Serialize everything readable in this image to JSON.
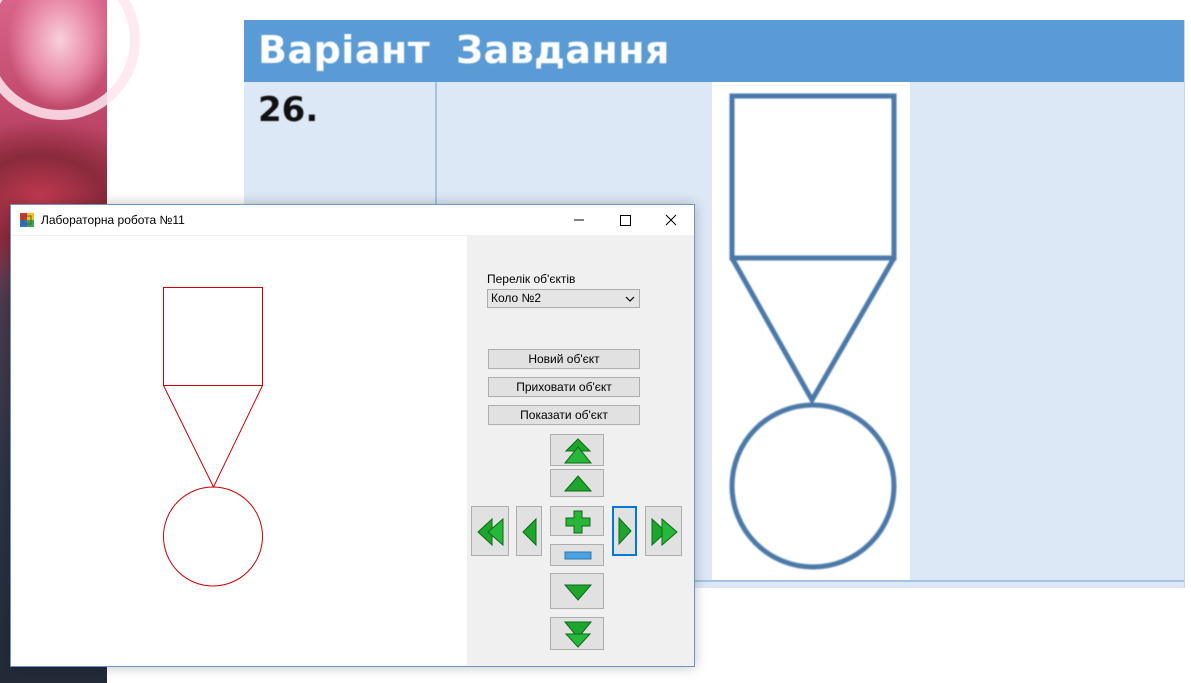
{
  "background_document": {
    "column_variant_header": "Варіант",
    "column_task_header": "Завдання",
    "variant_number": "26.",
    "header_color": "#5a9bd5"
  },
  "window": {
    "title": "Лабораторна робота №11",
    "minimize_icon": "minimize-icon",
    "maximize_icon": "maximize-icon",
    "close_icon": "close-icon"
  },
  "panel": {
    "objects_label": "Перелік об'єктів",
    "objects_select_value": "Коло №2",
    "new_object_button": "Новий об'єкт",
    "hide_object_button": "Приховати об'єкт",
    "show_object_button": "Показати об'єкт"
  },
  "control_icons": {
    "fast_up": "double-arrow-up-icon",
    "up": "arrow-up-icon",
    "fast_left": "double-arrow-left-icon",
    "left": "arrow-left-icon",
    "enlarge": "plus-icon",
    "shrink": "minus-icon",
    "right": "arrow-right-icon",
    "fast_right": "double-arrow-right-icon",
    "down": "arrow-down-icon",
    "fast_down": "double-arrow-down-icon"
  },
  "colors": {
    "shape_stroke": "#cc0000",
    "reference_shape_stroke": "#4a78a8",
    "control_arrow_fill": "#1ea52e"
  }
}
